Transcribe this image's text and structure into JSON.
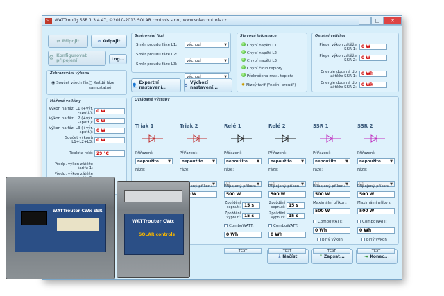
{
  "window": {
    "title": "WATTconfig SSR 1.3.4.47, ©2010-2013 SOLAR controls s.r.o., www.solarcontrols.cz",
    "logo": "SC"
  },
  "toolbar": {
    "connect": "Připojit",
    "disconnect": "Odpojit",
    "configure": "Konfigurovat připojení",
    "log": "Log..."
  },
  "phase_group": {
    "title": "Směrování fází",
    "rows": [
      {
        "label": "Směr proudu fáze L1:",
        "value": "výchozí"
      },
      {
        "label": "Směr proudu fáze L2:",
        "value": "výchozí"
      },
      {
        "label": "Směr proudu fáze L3:",
        "value": "výchozí"
      }
    ]
  },
  "status_group": {
    "title": "Stavová informace",
    "items": [
      "Chybí napětí L1",
      "Chybí napětí L2",
      "Chybí napětí L3",
      "Chybí čidlo teploty",
      "Překročena max. teplota",
      "Nízký tarif (\"noční proud\")"
    ]
  },
  "other_group": {
    "title": "Ostatní veličiny",
    "rows": [
      {
        "label": "Přepr. výkon zátěže SSR 1:",
        "value": "0 W"
      },
      {
        "label": "Přepr. výkon zátěže SSR 2:",
        "value": "0 W"
      },
      {
        "label": "Energie dodaná do zátěže SSR 1:",
        "value": "0 Wh"
      },
      {
        "label": "Energie dodaná do zátěže SSR 2:",
        "value": "0 Wh"
      }
    ]
  },
  "mode_group": {
    "title": "Zobrazování výkonu",
    "option1": "Součet všech fází",
    "option2": "Každá fáze samostatně"
  },
  "expert_button": "Expertní nastavení...",
  "default_button": "Výchozí nastavení...",
  "measure_group": {
    "title": "Měřené veličiny",
    "rows": [
      {
        "label": "Výkon na fázi L1 (+výr. -spotř.):",
        "value": "0 W"
      },
      {
        "label": "Výkon na fázi L2 (+výr. -spotř.):",
        "value": "0 W"
      },
      {
        "label": "Výkon na fázi L3 (+výr. -spotř.):",
        "value": "0 W"
      },
      {
        "label": "Součet výkonů L1+L2+L3:",
        "value": "0 W"
      }
    ],
    "temp_label": "Teplota relé:",
    "temp_value": "29 °C",
    "extra1": "Předp. výkon zátěže tarifu 1:",
    "extra2": "Předp. výkon zátěže tarifu 2:"
  },
  "outputs_group": {
    "title": "Ovládané výstupy"
  },
  "outputs": [
    {
      "name": "Triak 1",
      "assign_label": "Přiřazení:",
      "assign": "nepoužito",
      "phase_label": "Fáze:",
      "phase": "L1",
      "power_label": "Připojený příkon:",
      "power": "500 W"
    },
    {
      "name": "Triak 2",
      "assign_label": "Přiřazení:",
      "assign": "nepoužito",
      "phase_label": "Fáze:",
      "phase": "L1",
      "power_label": "Připojený příkon:",
      "power": "500 W"
    },
    {
      "name": "Relé 1",
      "assign_label": "Přiřazení:",
      "assign": "nepoužito",
      "phase_label": "Fáze:",
      "phase": "L1",
      "power_label": "Připojený příkon:",
      "power": "500 W",
      "on_label": "Zpoždění sepnutí:",
      "on": "15 s",
      "off_label": "Zpoždění vypnutí:",
      "off": "15 s",
      "combo": "ComboWATT:",
      "energy": "0 Wh",
      "test": "TEST"
    },
    {
      "name": "Relé 2",
      "assign_label": "Přiřazení:",
      "assign": "nepoužito",
      "phase_label": "Fáze:",
      "phase": "L1",
      "power_label": "Připojený příkon:",
      "power": "500 W",
      "on_label": "Zpoždění sepnutí:",
      "on": "15 s",
      "off_label": "Zpoždění vypnutí:",
      "off": "15 s",
      "combo": "ComboWATT:",
      "energy": "0 Wh",
      "test": "TEST"
    },
    {
      "name": "SSR 1",
      "assign_label": "Přiřazení:",
      "assign": "nepoužito",
      "phase_label": "Fáze:",
      "phase": "L1",
      "power_label": "Připojený příkon:",
      "power": "500 W",
      "max_label": "Maximální příkon:",
      "max": "500 W",
      "combo": "ComboWATT:",
      "energy": "0 Wh",
      "full": "plný výkon",
      "test": "TEST"
    },
    {
      "name": "SSR 2",
      "assign_label": "Přiřazení:",
      "assign": "nepoužito",
      "phase_label": "Fáze:",
      "phase": "L1",
      "power_label": "Připojený příkon:",
      "power": "500 W",
      "max_label": "Maximální příkon:",
      "max": "500 W",
      "combo": "ComboWATT:",
      "energy": "0 Wh",
      "full": "plný výkon",
      "test": "TEST"
    }
  ],
  "bottom": {
    "read": "Načíst",
    "write": "Zapsat...",
    "end": "Konec..."
  },
  "device": {
    "label1": "WATTrouter CWx SSR",
    "label2": "WATTrouter CWx",
    "brand": "SOLAR controls"
  }
}
